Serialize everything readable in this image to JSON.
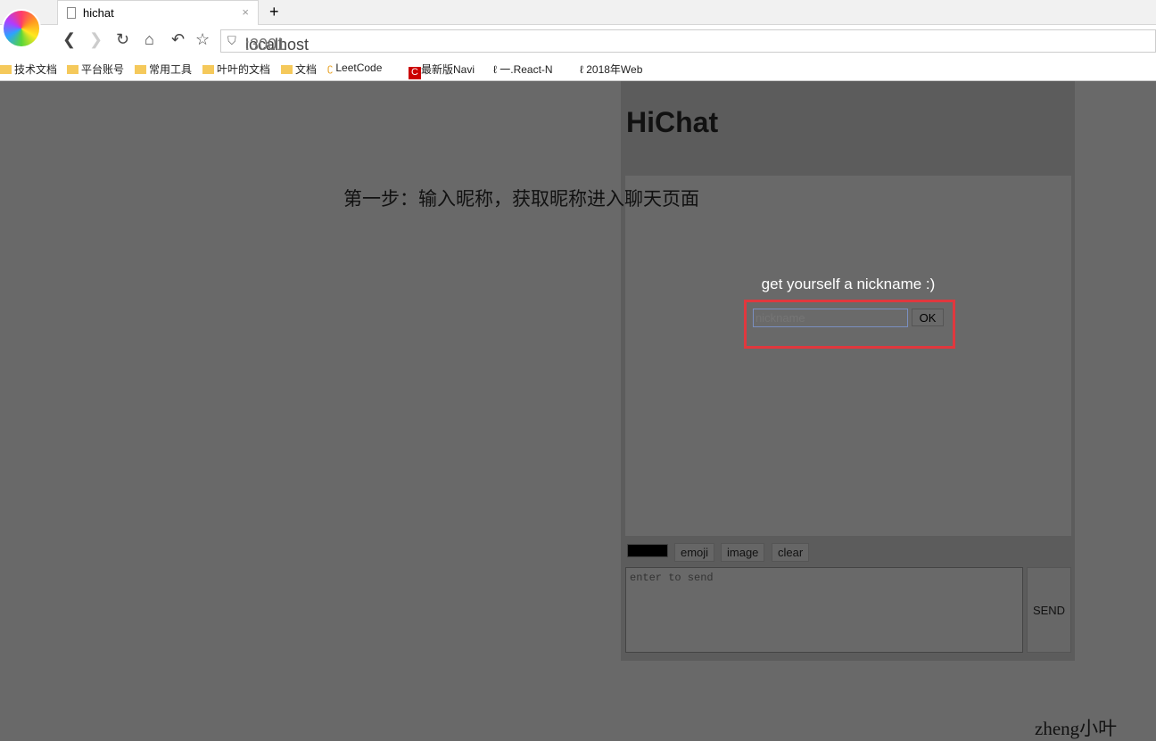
{
  "browser": {
    "tab_title": "hichat",
    "url_host": "localhost",
    "url_port": ":3001",
    "bookmarks": [
      {
        "label": "技术文档",
        "icon": "folder"
      },
      {
        "label": "平台账号",
        "icon": "folder"
      },
      {
        "label": "常用工具",
        "icon": "folder"
      },
      {
        "label": "叶叶的文档",
        "icon": "folder"
      },
      {
        "label": "文档",
        "icon": "folder"
      },
      {
        "label": "LeetCode",
        "icon": "leetcode"
      },
      {
        "label": "最新版Navi",
        "icon": "csdn"
      },
      {
        "label": "一.React-N",
        "icon": "link"
      },
      {
        "label": "2018年Web",
        "icon": "link"
      }
    ]
  },
  "app": {
    "title": "HiChat",
    "prompt": "get yourself a nickname :)",
    "nickname_placeholder": "nickname",
    "ok_label": "OK",
    "toolbar": {
      "emoji": "emoji",
      "image": "image",
      "clear": "clear"
    },
    "message_placeholder": "enter to send",
    "send_label": "SEND"
  },
  "annotation": {
    "caption": "第一步：输入昵称，获取昵称进入聊天页面",
    "watermark": "zheng小叶",
    "highlight_color": "#e0383e"
  }
}
